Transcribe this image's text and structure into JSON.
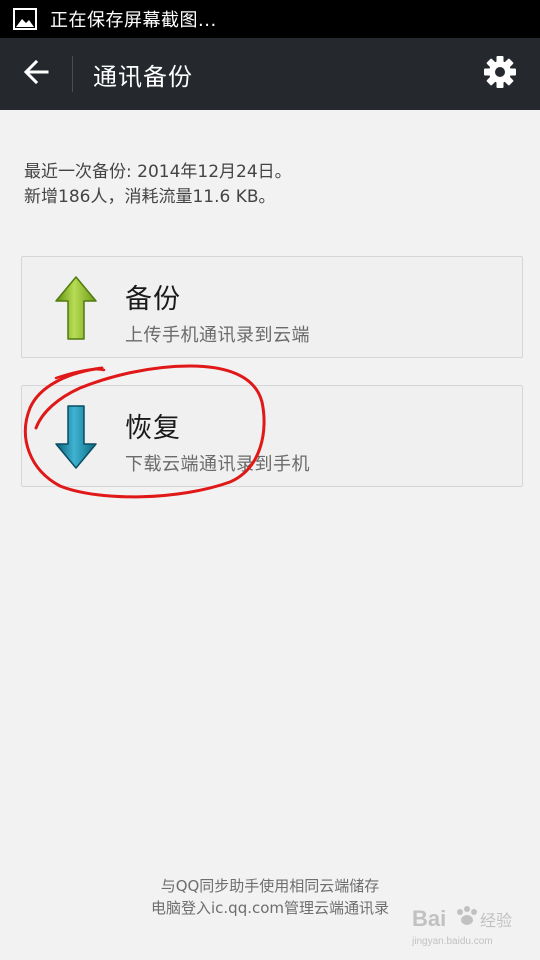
{
  "status_bar": {
    "notification_icon": "image-icon",
    "text": "正在保存屏幕截图..."
  },
  "app_bar": {
    "title": "通讯备份",
    "back_icon": "back-arrow-icon",
    "settings_icon": "gear-icon"
  },
  "backup_info": {
    "last_backup": "最近一次备份: 2014年12月24日。",
    "summary": "新增186人，消耗流量11.6 KB。"
  },
  "actions": [
    {
      "title": "备份",
      "subtitle": "上传手机通讯录到云端",
      "icon": "upload-arrow-icon",
      "icon_color": "#8fbe2c"
    },
    {
      "title": "恢复",
      "subtitle": "下载云端通讯录到手机",
      "icon": "download-arrow-icon",
      "icon_color": "#1f8ca8"
    }
  ],
  "footer": {
    "line1": "与QQ同步助手使用相同云端储存",
    "line2": "电脑登入ic.qq.com管理云端通讯录"
  },
  "watermark": {
    "brand": "Bai",
    "brand_cn": "经验",
    "url": "jingyan.baidu.com"
  },
  "colors": {
    "status_bar": "#000000",
    "app_bar": "#25292d",
    "background": "#f2f2f2",
    "annotation": "#e01818"
  }
}
